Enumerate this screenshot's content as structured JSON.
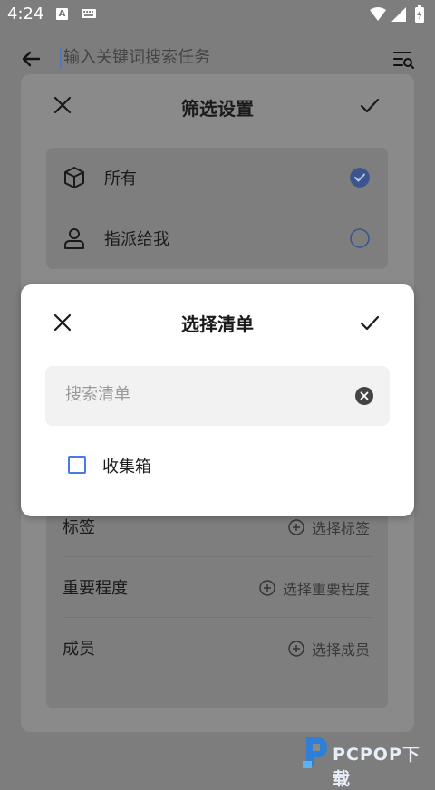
{
  "status_bar": {
    "time": "4:24",
    "a_badge": "A"
  },
  "search": {
    "placeholder": "输入关键词搜索任务"
  },
  "filter_sheet": {
    "title": "筛选设置",
    "scope_options": [
      {
        "label": "所有",
        "selected": true
      },
      {
        "label": "指派给我",
        "selected": false
      }
    ],
    "attributes": [
      {
        "label": "标签",
        "action": "选择标签"
      },
      {
        "label": "重要程度",
        "action": "选择重要程度"
      },
      {
        "label": "成员",
        "action": "选择成员"
      }
    ]
  },
  "dialog": {
    "title": "选择清单",
    "search_placeholder": "搜索清单",
    "search_value": "",
    "lists": [
      {
        "label": "收集箱",
        "checked": false
      }
    ]
  },
  "watermark": {
    "text": "PCPOP下载"
  },
  "colors": {
    "accent": "#4a7be0",
    "scrim": "#7d7d7d"
  }
}
